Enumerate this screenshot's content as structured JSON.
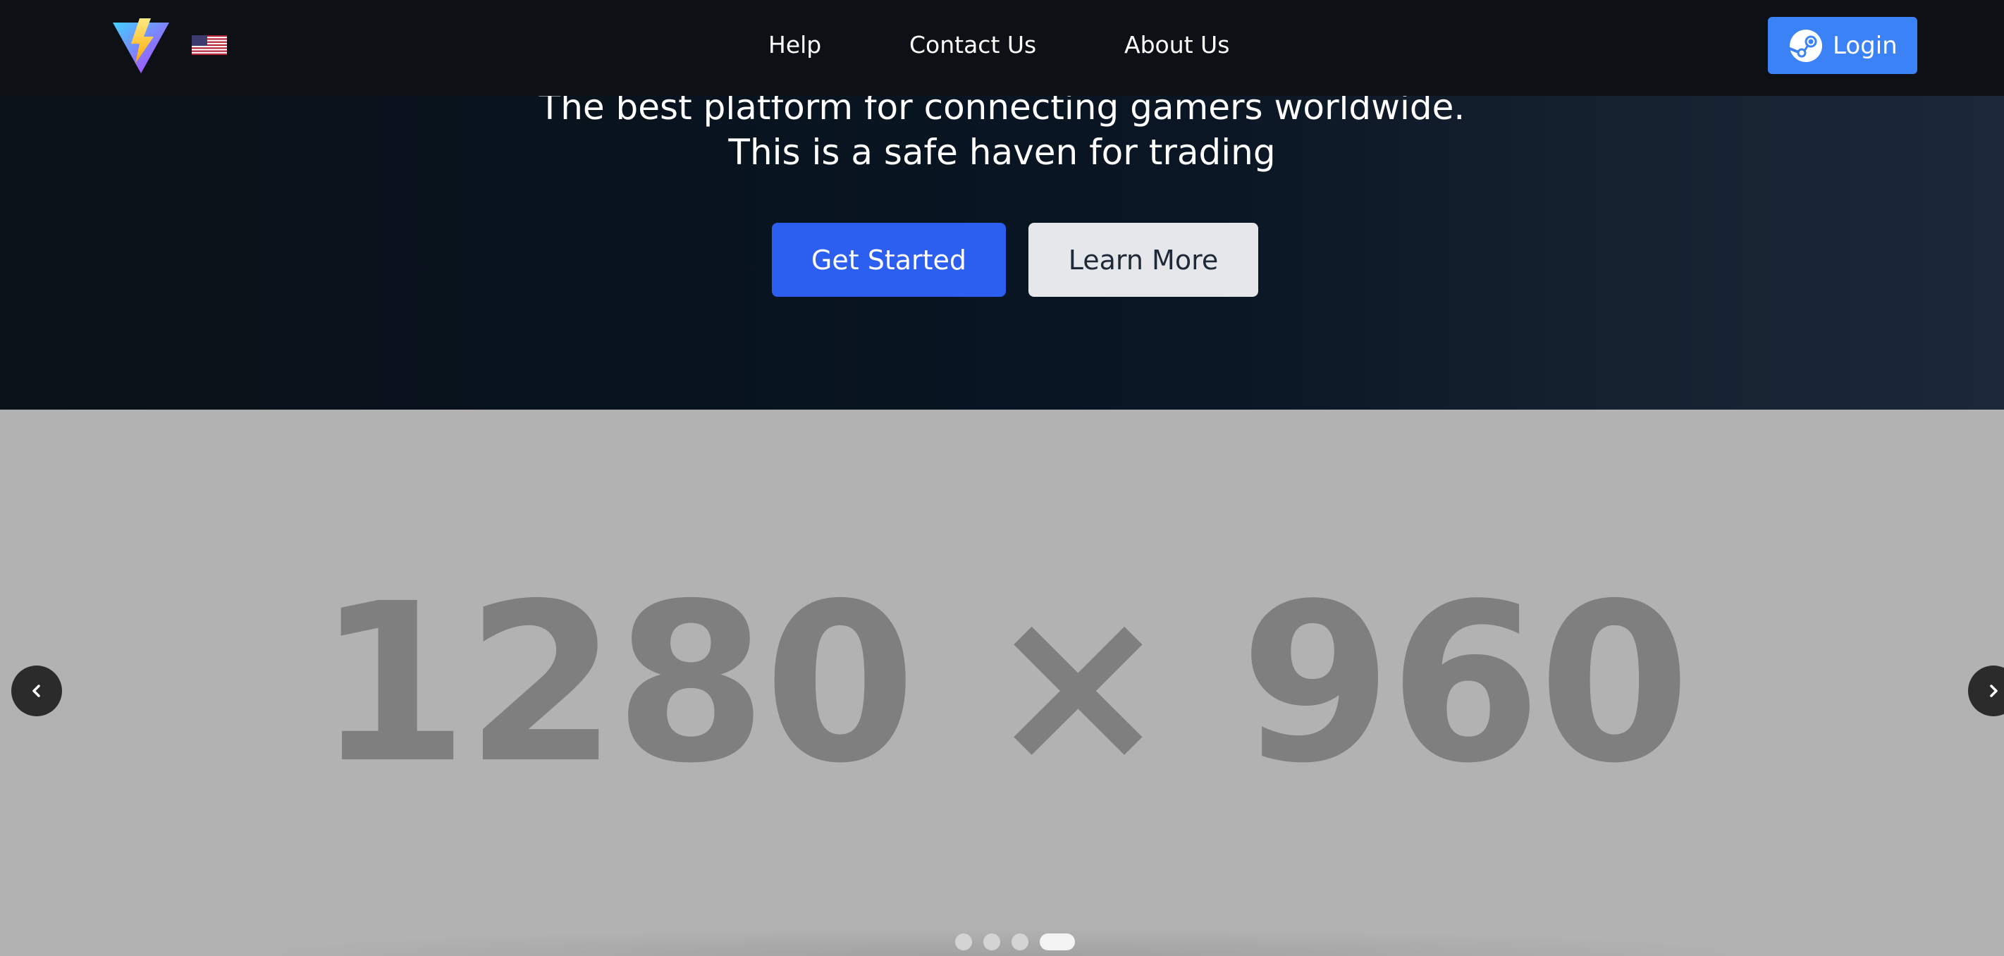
{
  "navbar": {
    "logo_icon": "lightning-triangle-logo",
    "flag_icon": "us-flag-icon",
    "links": [
      "Help",
      "Contact Us",
      "About Us"
    ],
    "login_label": "Login",
    "login_icon": "steam-icon",
    "login_color": "#3b82f6"
  },
  "hero": {
    "tagline_line1": "The best platform for connecting gamers worldwide.",
    "tagline_line2": "This is a safe haven for trading",
    "primary_button": "Get Started",
    "secondary_button": "Learn More",
    "primary_color": "#2c5ff0"
  },
  "carousel": {
    "placeholder_text": "1280 × 960",
    "prev_icon": "chevron-left-icon",
    "next_icon": "chevron-right-icon",
    "slide_count": 4,
    "active_slide": 4
  }
}
